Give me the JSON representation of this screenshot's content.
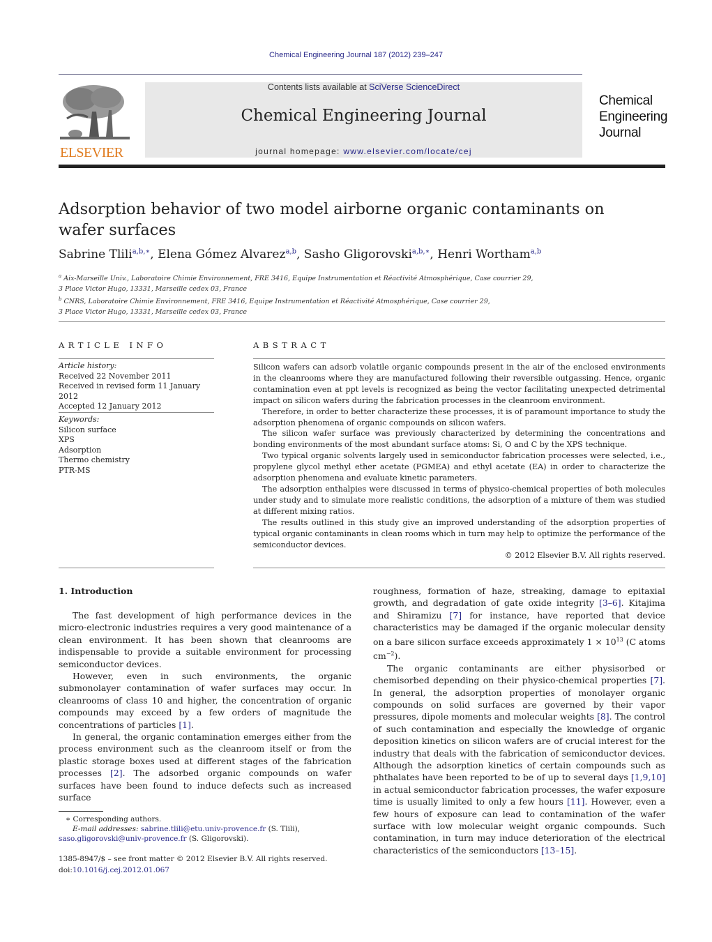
{
  "header": {
    "citation": "Chemical Engineering Journal 187 (2012) 239–247",
    "contents_prefix": "Contents lists available at ",
    "contents_link": "SciVerse ScienceDirect",
    "journal_title": "Chemical Engineering Journal",
    "homepage_prefix": "journal homepage: ",
    "homepage_link": "www.elsevier.com/locate/cej",
    "publisher_logo_text": "ELSEVIER",
    "publisher_logo_icon": "tree-engraving-icon",
    "cover_logo_lines": [
      "Chemical",
      "Engineering",
      "Journal"
    ],
    "colors": {
      "link": "#2a2a8a",
      "elsevier_orange": "#e07b1e",
      "banner_bg": "#e8e8e8"
    }
  },
  "article": {
    "title": "Adsorption behavior of two model airborne organic contaminants on wafer surfaces",
    "authors": [
      {
        "name": "Sabrine Tlili",
        "sup": "a,b,∗",
        "sep": ", "
      },
      {
        "name": "Elena Gómez Alvarez",
        "sup": "a,b",
        "sep": ", "
      },
      {
        "name": "Sasho Gligorovski",
        "sup": "a,b,∗",
        "sep": ", "
      },
      {
        "name": "Henri Wortham",
        "sup": "a,b",
        "sep": ""
      }
    ],
    "affiliations": [
      {
        "mark": "a",
        "line1": "Aix-Marseille Univ., Laboratoire Chimie Environnement, FRE 3416, Equipe Instrumentation et Réactivité Atmosphérique, Case courrier 29,",
        "line2": "3 Place Victor Hugo, 13331, Marseille cedex 03, France"
      },
      {
        "mark": "b",
        "line1": "CNRS, Laboratoire Chimie Environnement, FRE 3416, Equipe Instrumentation et Réactivité Atmosphérique, Case courrier 29,",
        "line2": "3 Place Victor Hugo, 13331, Marseille cedex 03, France"
      }
    ]
  },
  "article_info": {
    "heading": "ARTICLE INFO",
    "history_label": "Article history:",
    "history": [
      "Received 22 November 2011",
      "Received in revised form 11 January 2012",
      "Accepted 12 January 2012"
    ],
    "keywords_label": "Keywords:",
    "keywords": [
      "Silicon surface",
      "XPS",
      "Adsorption",
      "Thermo chemistry",
      "PTR-MS"
    ]
  },
  "abstract": {
    "heading": "ABSTRACT",
    "paragraphs": [
      "Silicon wafers can adsorb volatile organic compounds present in the air of the enclosed environments in the cleanrooms where they are manufactured following their reversible outgassing. Hence, organic contamination even at ppt levels is recognized as being the vector facilitating unexpected detrimental impact on silicon wafers during the fabrication processes in the cleanroom environment.",
      "Therefore, in order to better characterize these processes, it is of paramount importance to study the adsorption phenomena of organic compounds on silicon wafers.",
      "The silicon wafer surface was previously characterized by determining the concentrations and bonding environments of the most abundant surface atoms: Si, O and C by the XPS technique.",
      "Two typical organic solvents largely used in semiconductor fabrication processes were selected, i.e., propylene glycol methyl ether acetate (PGMEA) and ethyl acetate (EA) in order to characterize the adsorption phenomena and evaluate kinetic parameters.",
      "The adsorption enthalpies were discussed in terms of physico-chemical properties of both molecules under study and to simulate more realistic conditions, the adsorption of a mixture of them was studied at different mixing ratios.",
      "The results outlined in this study give an improved understanding of the adsorption properties of typical organic contaminants in clean rooms which in turn may help to optimize the performance of the semiconductor devices."
    ],
    "copyright": "© 2012 Elsevier B.V. All rights reserved."
  },
  "introduction": {
    "heading": "1.  Introduction",
    "col1": {
      "p1": "The fast development of high performance devices in the micro-electronic industries requires a very good maintenance of a clean environment. It has been shown that cleanrooms are indispensable to provide a suitable environment for processing semiconductor devices.",
      "p2_text": "However, even in such environments, the organic submonolayer contamination of wafer surfaces may occur. In cleanrooms of class 10 and higher, the concentration of organic compounds may exceed by a few orders of magnitude the concentrations of particles ",
      "p2_ref": "[1]",
      "p2_end": ".",
      "p3_text": "In general, the organic contamination emerges either from the process environment such as the cleanroom itself or from the plastic storage boxes used at different stages of the fabrication processes ",
      "p3_ref": "[2]",
      "p3_end": ". The adsorbed organic compounds on wafer surfaces have been found to induce defects such as increased surface"
    },
    "col2": {
      "p1_a": "roughness, formation of haze, streaking, damage to epitaxial growth, and degradation of gate oxide integrity ",
      "p1_ref1": "[3–6]",
      "p1_b": ". Kitajima and Shiramizu ",
      "p1_ref2": "[7]",
      "p1_c": " for instance, have reported that device characteristics may be damaged if the organic molecular density on a bare silicon surface exceeds approximately 1 × 10",
      "p1_exp": "13",
      "p1_d": " (C atoms cm",
      "p1_exp2": "−2",
      "p1_e": ").",
      "p2_a": "The organic contaminants are either physisorbed or chemisorbed depending on their physico-chemical properties ",
      "p2_ref1": "[7]",
      "p2_b": ". In general, the adsorption properties of monolayer organic compounds on solid surfaces are governed by their vapor pressures, dipole moments and molecular weights ",
      "p2_ref2": "[8]",
      "p2_c": ". The control of such contamination and especially the knowledge of organic deposition kinetics on silicon wafers are of crucial interest for the industry that deals with the fabrication of semiconductor devices. Although the adsorption kinetics of certain compounds such as phthalates have been reported to be of up to several days ",
      "p2_ref3": "[1,9,10]",
      "p2_d": " in actual semiconductor fabrication processes, the wafer exposure time is usually limited to only a few hours ",
      "p2_ref4": "[11]",
      "p2_e": ". However, even a few hours of exposure can lead to contamination of the wafer surface with low molecular weight organic compounds. Such contamination, in turn may induce deterioration of the electrical characteristics of the semiconductors ",
      "p2_ref5": "[13–15]",
      "p2_f": "."
    }
  },
  "footnotes": {
    "corresponding": "∗  Corresponding authors.",
    "email_label": "E-mail addresses:",
    "email1": "sabrine.tlili@etu.univ-provence.fr",
    "email1_owner": " (S. Tlili),",
    "email2": "saso.gligorovski@univ-provence.fr",
    "email2_owner": " (S. Gligorovski).",
    "front_matter": "1385-8947/$ – see front matter © 2012 Elsevier B.V. All rights reserved.",
    "doi_prefix": "doi:",
    "doi": "10.1016/j.cej.2012.01.067"
  }
}
